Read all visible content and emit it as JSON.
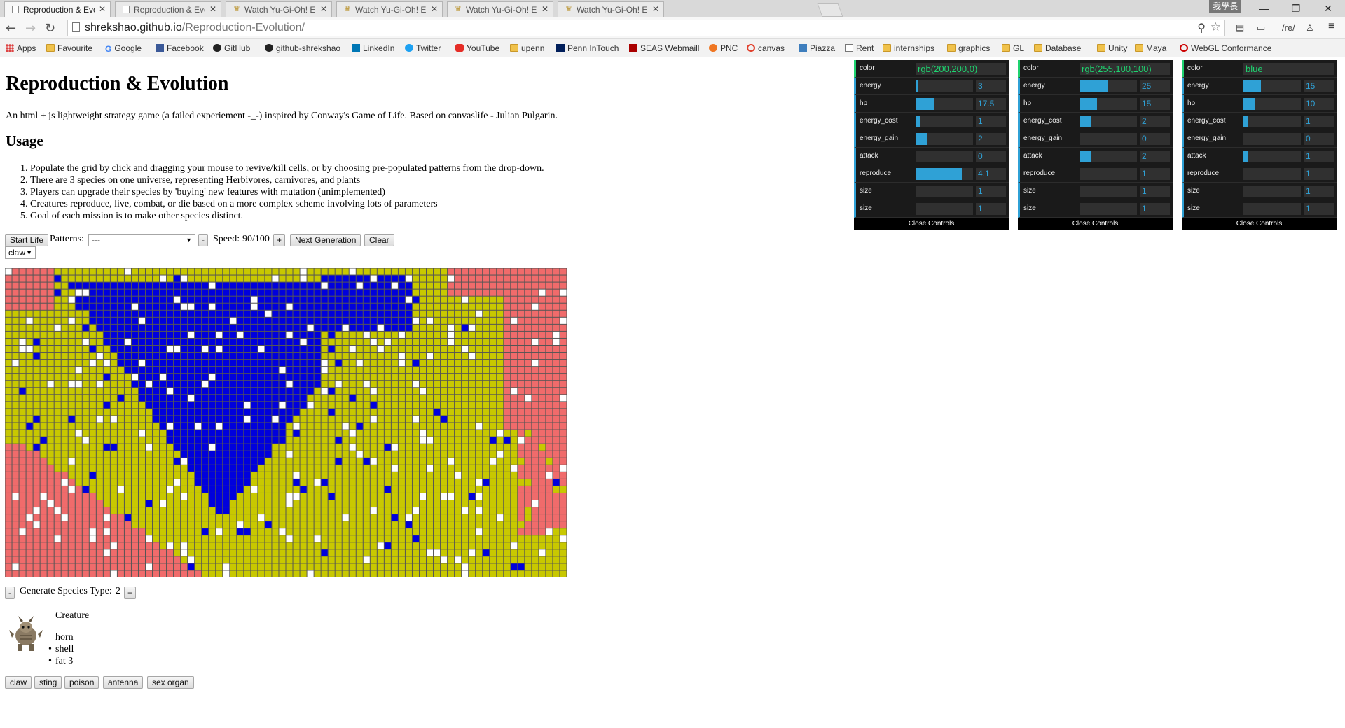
{
  "browser": {
    "tabs": [
      {
        "title": "Reproduction & Evolution",
        "active": true,
        "favicon": "page-icon"
      },
      {
        "title": "Reproduction & Evolution",
        "active": false,
        "favicon": "page-icon"
      },
      {
        "title": "Watch Yu-Gi-Oh! Episo",
        "active": false,
        "favicon": "yugioh-icon"
      },
      {
        "title": "Watch Yu-Gi-Oh! Episode",
        "active": false,
        "favicon": "yugioh-icon"
      },
      {
        "title": "Watch Yu-Gi-Oh! Episode",
        "active": false,
        "favicon": "yugioh-icon"
      },
      {
        "title": "Watch Yu-Gi-Oh! Episode",
        "active": false,
        "favicon": "yugioh-icon"
      }
    ],
    "ime_label": "我學長",
    "url_host": "shrekshao.github.io",
    "url_path": "/Reproduction-Evolution/",
    "ext_label": "/re/",
    "bookmarks": [
      {
        "label": "Apps",
        "icon": "apps"
      },
      {
        "label": "Favourite",
        "icon": "folder"
      },
      {
        "label": "Google",
        "icon": "g"
      },
      {
        "label": "Facebook",
        "icon": "fb"
      },
      {
        "label": "GitHub",
        "icon": "gh"
      },
      {
        "label": "github-shrekshao",
        "icon": "gh"
      },
      {
        "label": "LinkedIn",
        "icon": "li"
      },
      {
        "label": "Twitter",
        "icon": "tw"
      },
      {
        "label": "YouTube",
        "icon": "yt"
      },
      {
        "label": "upenn",
        "icon": "folder"
      },
      {
        "label": "Penn InTouch",
        "icon": "penn"
      },
      {
        "label": "SEAS Webmaill",
        "icon": "seas"
      },
      {
        "label": "PNC",
        "icon": "pnc"
      },
      {
        "label": "canvas",
        "icon": "canvas"
      },
      {
        "label": "Piazza",
        "icon": "piazza"
      },
      {
        "label": "Rent",
        "icon": "page"
      },
      {
        "label": "internships",
        "icon": "folder"
      },
      {
        "label": "graphics",
        "icon": "folder"
      },
      {
        "label": "GL",
        "icon": "folder"
      },
      {
        "label": "Database",
        "icon": "folder"
      },
      {
        "label": "Unity",
        "icon": "folder"
      },
      {
        "label": "Maya",
        "icon": "folder"
      },
      {
        "label": "WebGL Conformance",
        "icon": "webgl"
      }
    ]
  },
  "page": {
    "title": "Reproduction & Evolution",
    "description": "An html + js lightweight strategy game (a failed experiement -_-) inspired by Conway's Game of Life. Based on canvaslife - Julian Pulgarin.",
    "usage_heading": "Usage",
    "usage_items": [
      "Populate the grid by click and dragging your mouse to revive/kill cells, or by choosing pre-populated patterns from the drop-down.",
      "There are 3 species on one universe, representing Herbivores, carnivores, and plants",
      "Players can upgrade their species by 'buying' new features with mutation (unimplemented)",
      "Creatures reproduce, live, combat, or die based on a more complex scheme involving lots of parameters",
      "Goal of each mission is to make other species distinct."
    ]
  },
  "controls": {
    "start_label": "Start Life",
    "patterns_label": "Patterns:",
    "patterns_value": "---",
    "minus": "-",
    "plus": "+",
    "speed_label": "Speed:",
    "speed_value": "90/100",
    "next_label": "Next Generation",
    "clear_label": "Clear",
    "feature_select": "claw"
  },
  "grid": {
    "cols": 80,
    "rows": 44,
    "colors": {
      "red": "#f06b6b",
      "yellow": "#c8c800",
      "blue": "#0000dd",
      "white": "#ffffff",
      "line": "#555555"
    }
  },
  "species": {
    "minus": "-",
    "label": "Generate Species Type:",
    "value": "2",
    "plus": "+"
  },
  "creature": {
    "title": "Creature",
    "traits": [
      "horn",
      "shell",
      "fat 3"
    ],
    "buttons": [
      "claw",
      "sting",
      "poison",
      "antenna",
      "sex organ"
    ]
  },
  "panels": [
    {
      "color": "rgb(200,200,0)",
      "rows": [
        {
          "name": "energy",
          "value": "3",
          "fill": 0.05
        },
        {
          "name": "hp",
          "value": "17.5",
          "fill": 0.33
        },
        {
          "name": "energy_cost",
          "value": "1",
          "fill": 0.08
        },
        {
          "name": "energy_gain",
          "value": "2",
          "fill": 0.2
        },
        {
          "name": "attack",
          "value": "0",
          "fill": 0
        },
        {
          "name": "reproduce",
          "value": "4.1",
          "fill": 0.81
        },
        {
          "name": "size",
          "value": "1",
          "fill": 0
        },
        {
          "name": "size",
          "value": "1",
          "fill": 0
        }
      ],
      "close": "Close Controls"
    },
    {
      "color": "rgb(255,100,100)",
      "rows": [
        {
          "name": "energy",
          "value": "25",
          "fill": 0.5
        },
        {
          "name": "hp",
          "value": "15",
          "fill": 0.3
        },
        {
          "name": "energy_cost",
          "value": "2",
          "fill": 0.2
        },
        {
          "name": "energy_gain",
          "value": "0",
          "fill": 0
        },
        {
          "name": "attack",
          "value": "2",
          "fill": 0.2
        },
        {
          "name": "reproduce",
          "value": "1",
          "fill": 0
        },
        {
          "name": "size",
          "value": "1",
          "fill": 0
        },
        {
          "name": "size",
          "value": "1",
          "fill": 0
        }
      ],
      "close": "Close Controls"
    },
    {
      "color": "blue",
      "rows": [
        {
          "name": "energy",
          "value": "15",
          "fill": 0.3
        },
        {
          "name": "hp",
          "value": "10",
          "fill": 0.2
        },
        {
          "name": "energy_cost",
          "value": "1",
          "fill": 0.08
        },
        {
          "name": "energy_gain",
          "value": "0",
          "fill": 0
        },
        {
          "name": "attack",
          "value": "1",
          "fill": 0.08
        },
        {
          "name": "reproduce",
          "value": "1",
          "fill": 0
        },
        {
          "name": "size",
          "value": "1",
          "fill": 0
        },
        {
          "name": "size",
          "value": "1",
          "fill": 0
        }
      ],
      "close": "Close Controls"
    }
  ]
}
